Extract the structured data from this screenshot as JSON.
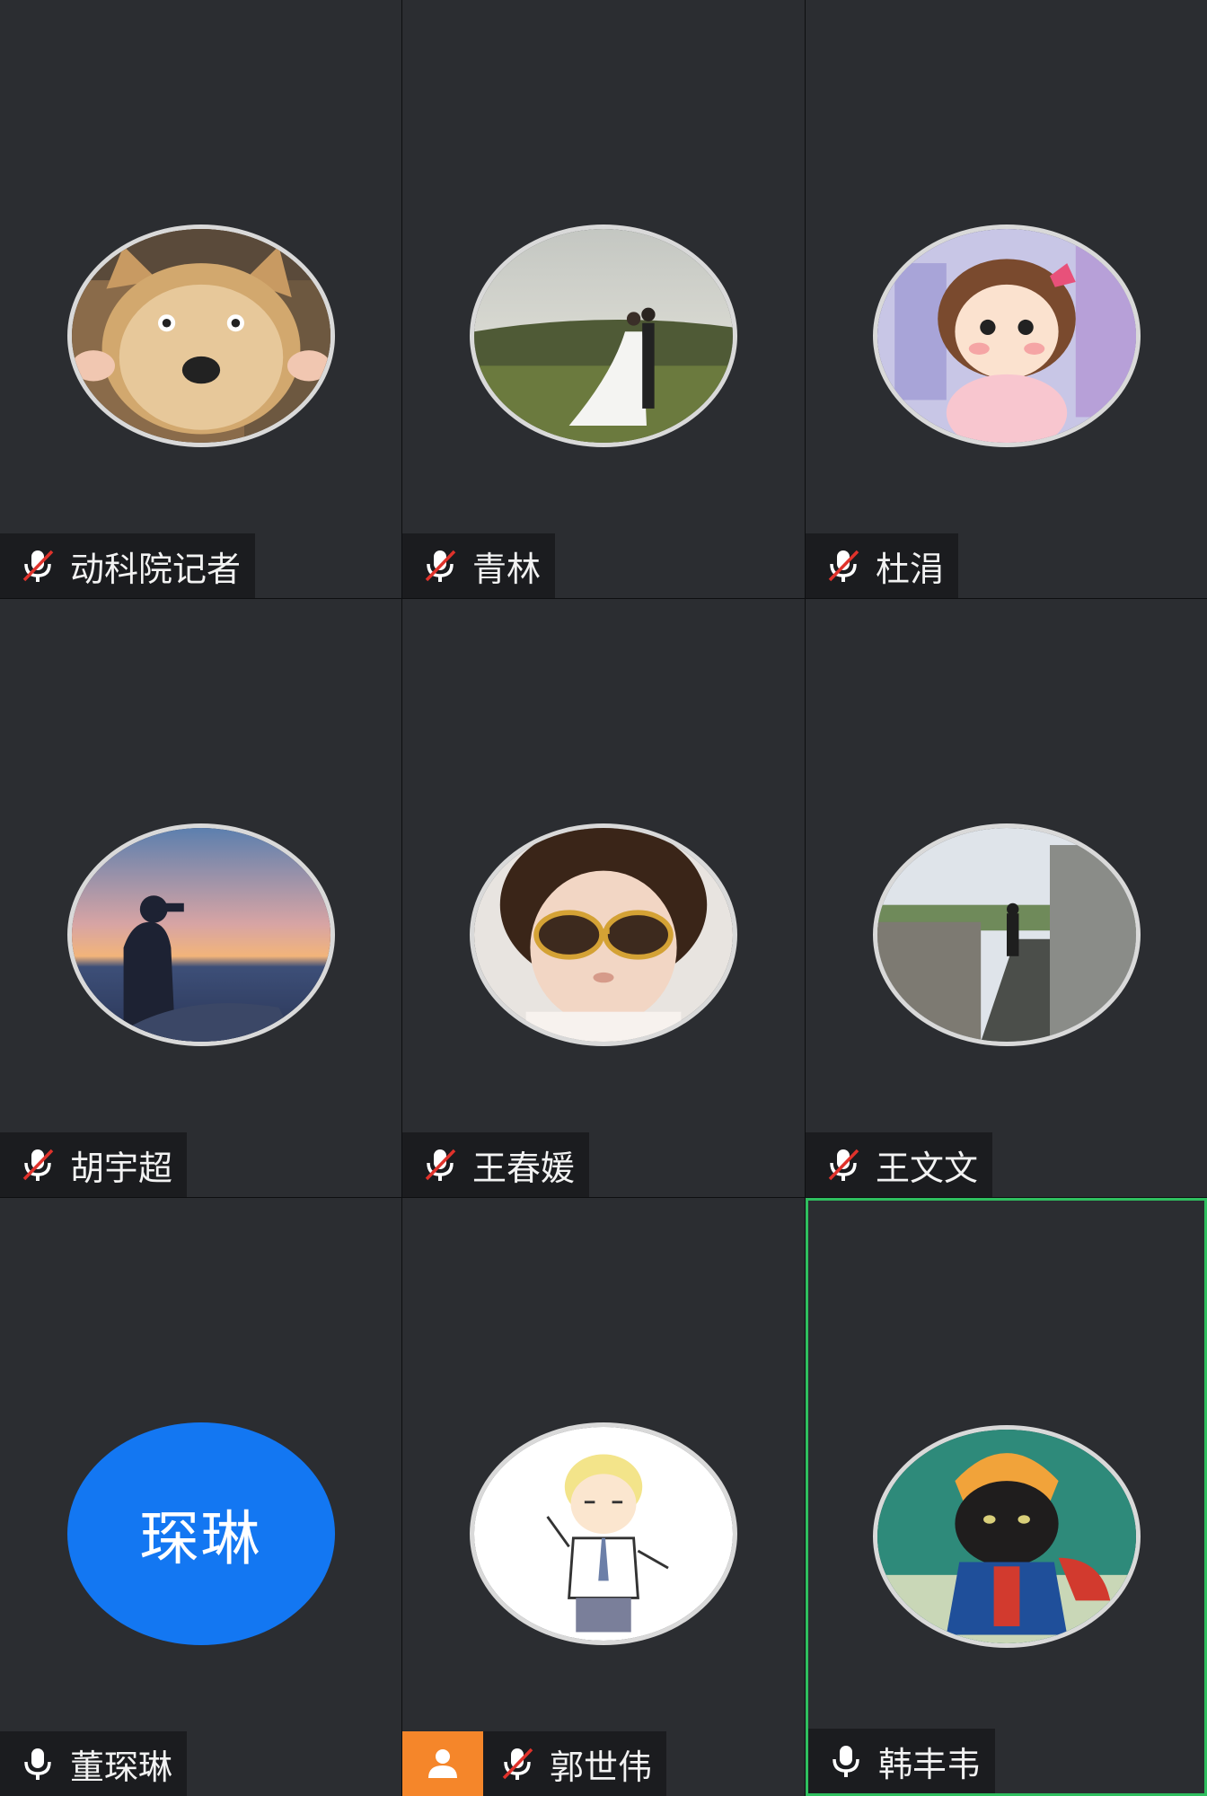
{
  "participants": [
    {
      "name": "动科院记者",
      "mic": "muted",
      "avatar": "shiba-bread-photo",
      "initials": null,
      "speaking": false,
      "host": false
    },
    {
      "name": "青林",
      "mic": "muted",
      "avatar": "wedding-couple-photo",
      "initials": null,
      "speaking": false,
      "host": false
    },
    {
      "name": "杜涓",
      "mic": "muted",
      "avatar": "cartoon-girl",
      "initials": null,
      "speaking": false,
      "host": false
    },
    {
      "name": "胡宇超",
      "mic": "muted",
      "avatar": "sunset-sea-silhouette",
      "initials": null,
      "speaking": false,
      "host": false
    },
    {
      "name": "王春媛",
      "mic": "muted",
      "avatar": "child-sunglasses-photo",
      "initials": null,
      "speaking": false,
      "host": false
    },
    {
      "name": "王文文",
      "mic": "muted",
      "avatar": "stone-bridge-photo",
      "initials": null,
      "speaking": false,
      "host": false
    },
    {
      "name": "董琛琳",
      "mic": "on",
      "avatar": "initials",
      "initials": "琛琳",
      "speaking": false,
      "host": false
    },
    {
      "name": "郭世伟",
      "mic": "muted",
      "avatar": "cartoon-boy",
      "initials": null,
      "speaking": false,
      "host": true
    },
    {
      "name": "韩丰韦",
      "mic": "on",
      "avatar": "cartoon-cat-tiger-hat",
      "initials": null,
      "speaking": true,
      "host": false
    }
  ],
  "colors": {
    "tile_bg": "#2b2d31",
    "nameplate_bg": "#1b1c1f",
    "speaking_border": "#2fbf5f",
    "initials_bg": "#1377f2",
    "host_badge": "#f5862a",
    "mute_slash": "#e0322b"
  }
}
